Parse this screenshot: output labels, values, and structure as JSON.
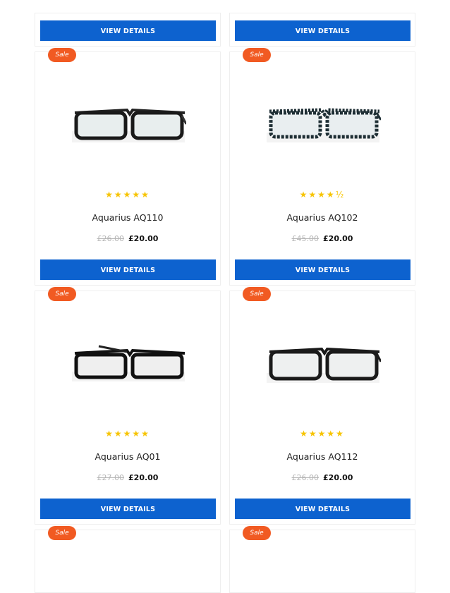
{
  "colors": {
    "accent": "#0d62cf",
    "sale": "#f15a22",
    "star": "#f7c400"
  },
  "top_buttons": [
    {
      "label": "VIEW DETAILS"
    },
    {
      "label": "VIEW DETAILS"
    }
  ],
  "products": [
    {
      "sale": "Sale",
      "stars": "★★★★★",
      "rating": 5,
      "title": "Aquarius AQ110",
      "old_price": "£26.00",
      "price": "£20.00",
      "button": "VIEW DETAILS"
    },
    {
      "sale": "Sale",
      "stars": "★★★★½",
      "rating": 4.5,
      "title": "Aquarius AQ102",
      "old_price": "£45.00",
      "price": "£20.00",
      "button": "VIEW DETAILS"
    },
    {
      "sale": "Sale",
      "stars": "★★★★★",
      "rating": 5,
      "title": "Aquarius AQ01",
      "old_price": "£27.00",
      "price": "£20.00",
      "button": "VIEW DETAILS"
    },
    {
      "sale": "Sale",
      "stars": "★★★★★",
      "rating": 5,
      "title": "Aquarius AQ112",
      "old_price": "£26.00",
      "price": "£20.00",
      "button": "VIEW DETAILS"
    }
  ],
  "bottom_partial": [
    {
      "sale": "Sale"
    },
    {
      "sale": "Sale"
    }
  ]
}
